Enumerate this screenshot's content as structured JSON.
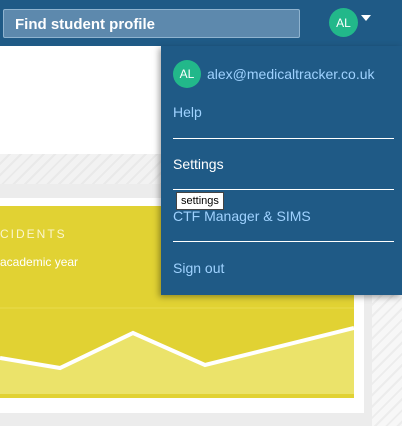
{
  "header": {
    "search_placeholder": "Find student profile",
    "avatar_initials": "AL"
  },
  "background": {
    "card_label": "CIDENTS",
    "card_subtitle": "academic year",
    "chart_colors": {
      "card": "#e1d233",
      "fill": "#ebe36a",
      "line": "#ffffff"
    }
  },
  "account_menu": {
    "avatar_initials": "AL",
    "email": "alex@medicaltracker.co.uk",
    "items": [
      {
        "label": "Help"
      },
      {
        "label": "Settings"
      },
      {
        "label": "CTF Manager & SIMS"
      },
      {
        "label": "Sign out"
      }
    ],
    "tooltip": "settings"
  },
  "colors": {
    "brand": "#1f5a86",
    "link": "#9fd2ff",
    "avatar": "#22b88a"
  }
}
